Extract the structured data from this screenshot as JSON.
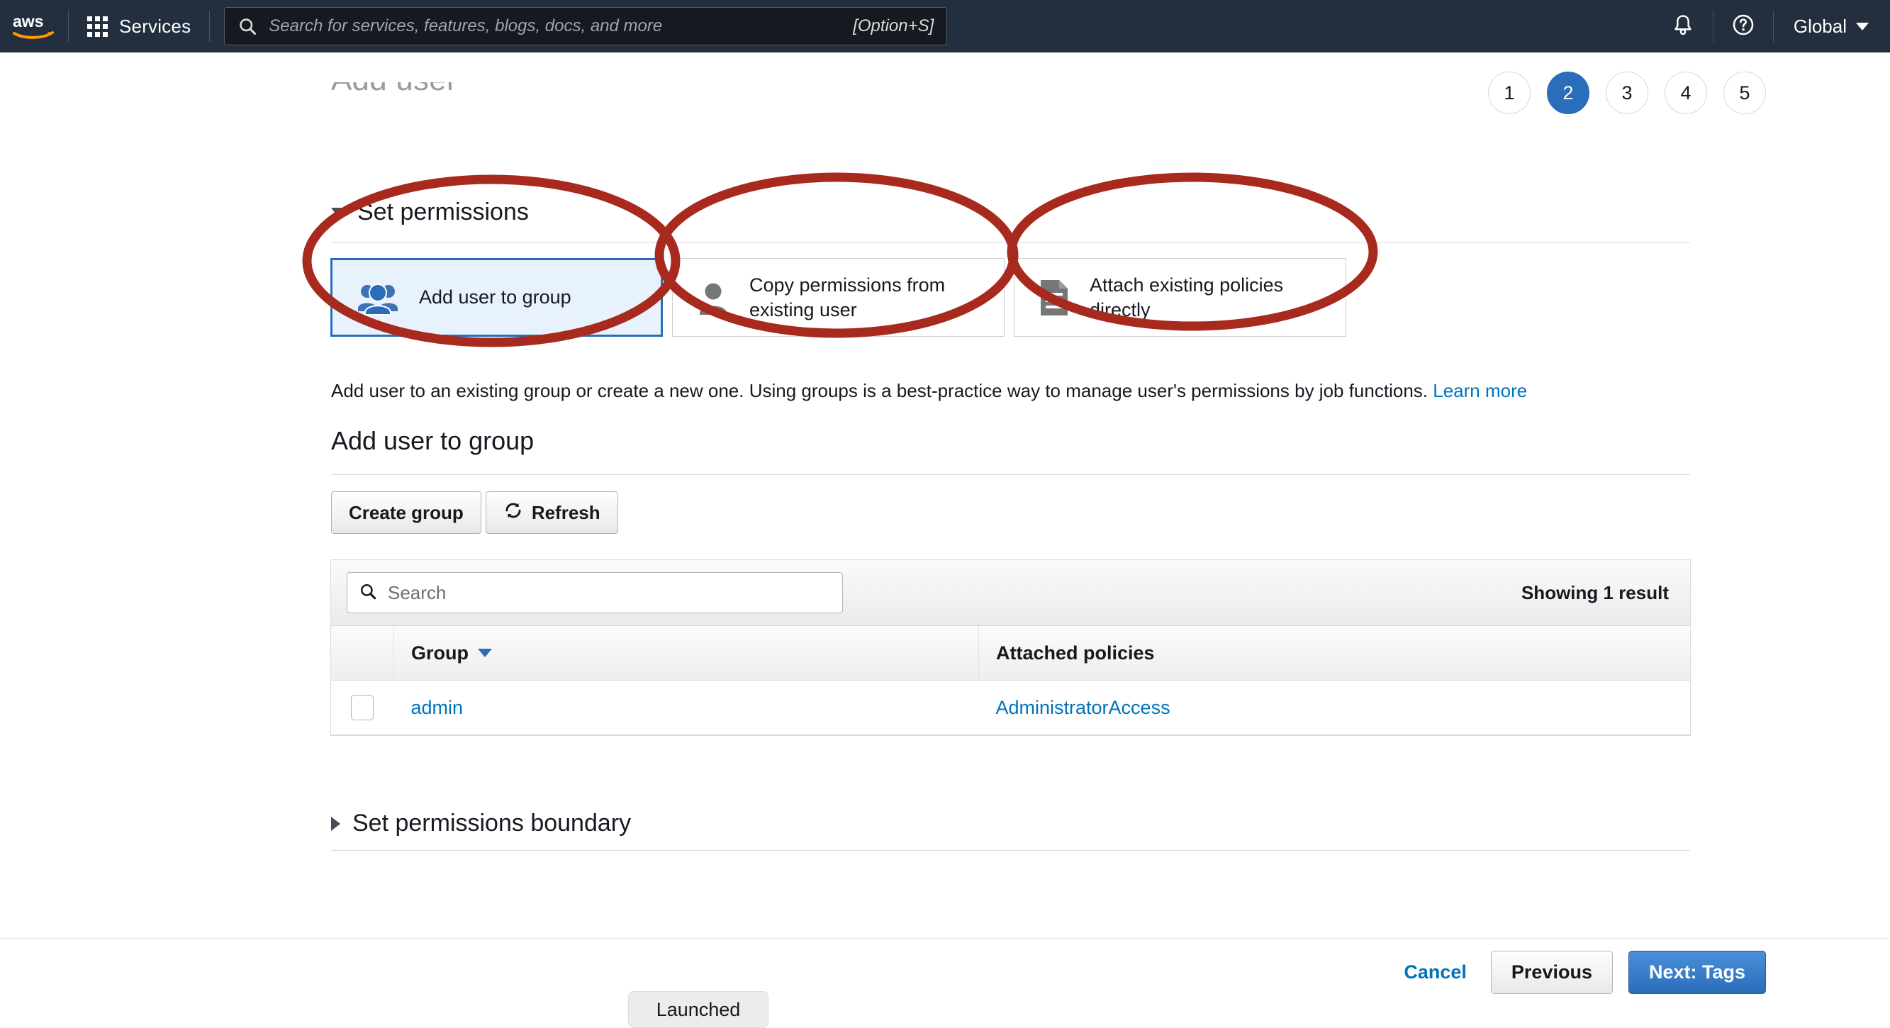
{
  "nav": {
    "logo_icon": "aws-logo",
    "grid_icon": "grid-icon",
    "services_label": "Services",
    "search_icon": "search-icon",
    "search_placeholder": "Search for services, features, blogs, docs, and more",
    "search_value": "",
    "shortcut_hint": "[Option+S]",
    "bell_icon": "bell-icon",
    "help_icon": "help-circle-icon",
    "region_label": "Global",
    "region_caret_icon": "chevron-down-icon",
    "background_color": "#232f3e"
  },
  "wizard": {
    "title": "Add user",
    "steps": [
      "1",
      "2",
      "3",
      "4",
      "5"
    ],
    "active_step": "2",
    "active_step_color": "#2a6ebb"
  },
  "permissions": {
    "section_title": "Set permissions",
    "expanded": true,
    "cards": [
      {
        "label": "Add user to group",
        "icon": "users-group-icon",
        "selected": true
      },
      {
        "label": "Copy permissions from existing user",
        "icon": "user-icon",
        "selected": false
      },
      {
        "label": "Attach existing policies directly",
        "icon": "document-lines-icon",
        "selected": false
      }
    ],
    "help_text": "Add user to an existing group or create a new one. Using groups is a best-practice way to manage user's permissions by job functions.",
    "help_link": "Learn more",
    "selected_card_border_color": "#2a6ebb",
    "selected_card_fill_color": "#e8f2fc"
  },
  "group_section": {
    "title": "Add user to group",
    "create_group_label": "Create group",
    "refresh_label": "Refresh",
    "refresh_icon": "refresh-icon",
    "search_icon": "search-icon",
    "search_placeholder": "Search",
    "search_value": "",
    "result_count": "Showing 1 result",
    "columns": [
      "",
      "Group",
      "Attached policies"
    ],
    "sort_column": "Group",
    "sort_caret_icon": "caret-down-icon",
    "rows": [
      {
        "checked": false,
        "group": "admin",
        "policies": "AdministratorAccess"
      }
    ]
  },
  "boundary": {
    "section_title": "Set permissions boundary",
    "expanded": false
  },
  "footer": {
    "cancel_label": "Cancel",
    "previous_label": "Previous",
    "next_label": "Next: Tags",
    "next_color": "#2a6ebb"
  },
  "overlay": {
    "launched_pill_label": "Launched",
    "annotation_color": "#a82a1e",
    "annotation_count": 3
  }
}
